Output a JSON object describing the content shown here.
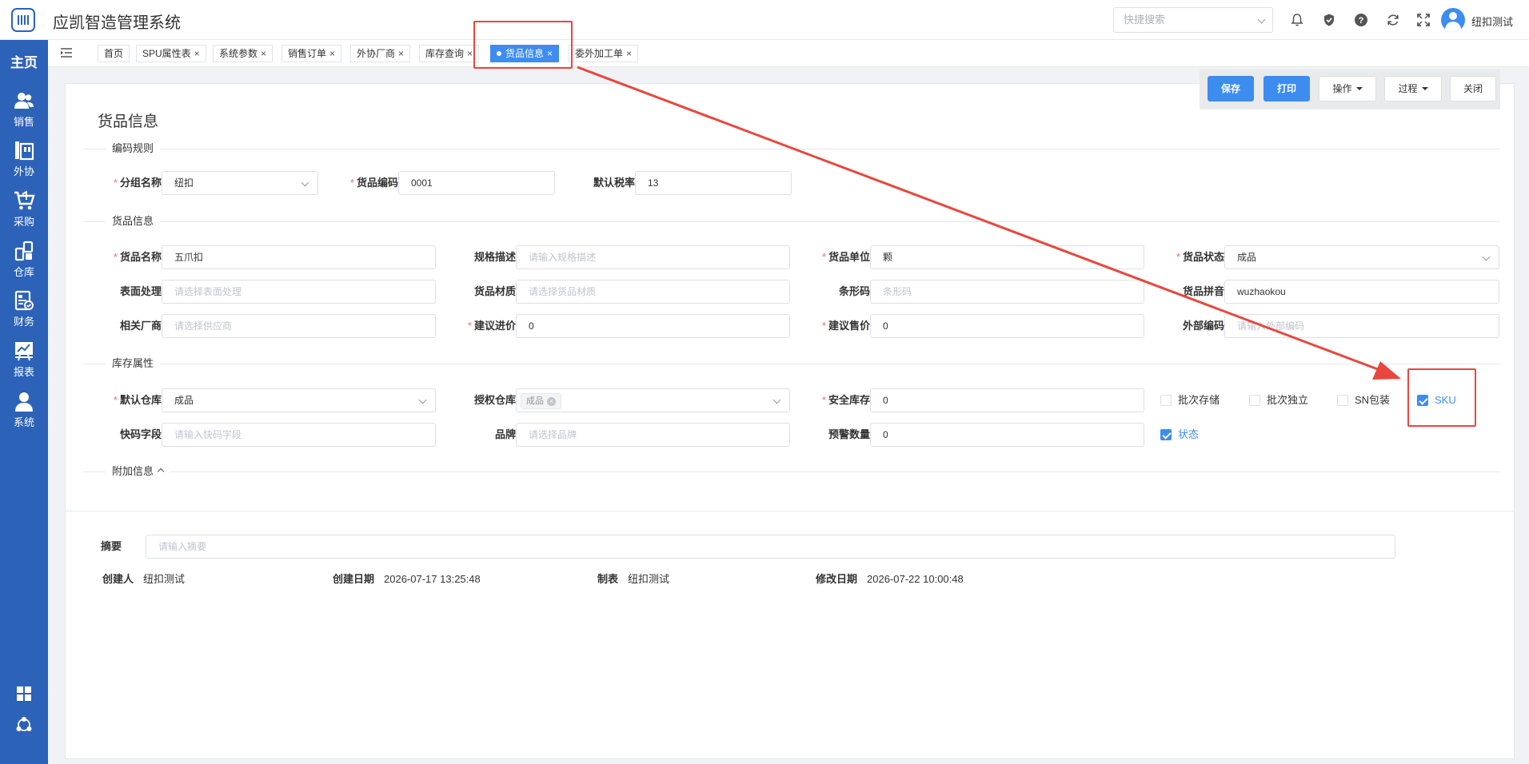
{
  "header": {
    "app_title": "应凯智造管理系统",
    "search_placeholder": "快捷搜索",
    "username": "纽扣测试",
    "icons": [
      "bell-icon",
      "shield-icon",
      "help-icon",
      "refresh-icon",
      "fullscreen-icon"
    ]
  },
  "sidebar": {
    "home": "主页",
    "items": [
      {
        "label": "销售",
        "icon": "users-icon"
      },
      {
        "label": "外协",
        "icon": "factory-icon"
      },
      {
        "label": "采购",
        "icon": "cart-icon"
      },
      {
        "label": "仓库",
        "icon": "warehouse-icon"
      },
      {
        "label": "财务",
        "icon": "finance-icon"
      },
      {
        "label": "报表",
        "icon": "chart-icon"
      },
      {
        "label": "系统",
        "icon": "person-icon"
      }
    ],
    "bottom_icons": [
      "grid-icon",
      "network-icon"
    ]
  },
  "tabs": [
    {
      "label": "首页",
      "closable": false
    },
    {
      "label": "SPU属性表",
      "closable": true
    },
    {
      "label": "系统参数",
      "closable": true
    },
    {
      "label": "销售订单",
      "closable": true
    },
    {
      "label": "外协厂商",
      "closable": true
    },
    {
      "label": "库存查询",
      "closable": true
    },
    {
      "label": "货品信息",
      "closable": true,
      "active": true
    },
    {
      "label": "委外加工单",
      "closable": true
    }
  ],
  "close_glyph": "×",
  "toolbar": {
    "save": "保存",
    "print": "打印",
    "operate": "操作",
    "process": "过程",
    "close": "关闭"
  },
  "page_title": "货品信息",
  "sections": {
    "coding": "编码规则",
    "goods": "货品信息",
    "stock": "库存属性",
    "extra": "附加信息"
  },
  "required_mark": "*",
  "fields": {
    "group_name": {
      "label": "分组名称",
      "value": "纽扣"
    },
    "goods_code": {
      "label": "货品编码",
      "value": "0001"
    },
    "tax_rate": {
      "label": "默认税率",
      "value": "13"
    },
    "goods_name": {
      "label": "货品名称",
      "value": "五爪扣"
    },
    "spec_desc": {
      "label": "规格描述",
      "placeholder": "请输入规格描述"
    },
    "unit": {
      "label": "货品单位",
      "value": "颗"
    },
    "status": {
      "label": "货品状态",
      "value": "成品"
    },
    "surface": {
      "label": "表面处理",
      "placeholder": "请选择表面处理"
    },
    "material": {
      "label": "货品材质",
      "placeholder": "请选择货品材质"
    },
    "barcode": {
      "label": "条形码",
      "placeholder": "条形码"
    },
    "pinyin": {
      "label": "货品拼音",
      "value": "wuzhaokou"
    },
    "vendor": {
      "label": "相关厂商",
      "placeholder": "请选择供应商"
    },
    "buy_price": {
      "label": "建议进价",
      "value": "0"
    },
    "sell_price": {
      "label": "建议售价",
      "value": "0"
    },
    "ext_code": {
      "label": "外部编码",
      "placeholder": "请输入外部编码"
    },
    "default_wh": {
      "label": "默认仓库",
      "value": "成品"
    },
    "auth_wh": {
      "label": "授权仓库",
      "tag": "成品"
    },
    "safety_stock": {
      "label": "安全库存",
      "value": "0"
    },
    "quick_code": {
      "label": "快码字段",
      "placeholder": "请输入快码字段"
    },
    "brand": {
      "label": "品牌",
      "placeholder": "请选择品牌"
    },
    "warn_qty": {
      "label": "预警数量",
      "value": "0"
    }
  },
  "checkboxes": {
    "batch_store": {
      "label": "批次存储",
      "checked": false
    },
    "batch_indep": {
      "label": "批次独立",
      "checked": false
    },
    "sn_pack": {
      "label": "SN包装",
      "checked": false
    },
    "sku": {
      "label": "SKU",
      "checked": true
    },
    "state": {
      "label": "状态",
      "checked": true
    }
  },
  "summary": {
    "label": "摘要",
    "placeholder": "请输入摘要"
  },
  "meta": {
    "creator_label": "创建人",
    "creator": "纽扣测试",
    "created_label": "创建日期",
    "created": "2026-07-17 13:25:48",
    "maker_label": "制表",
    "maker": "纽扣测试",
    "modified_label": "修改日期",
    "modified": "2026-07-22 10:00:48"
  },
  "colors": {
    "sidebar": "#2c62b8",
    "primary": "#3d8cf0",
    "annotation": "#e8473d",
    "required": "#f56c6c"
  }
}
